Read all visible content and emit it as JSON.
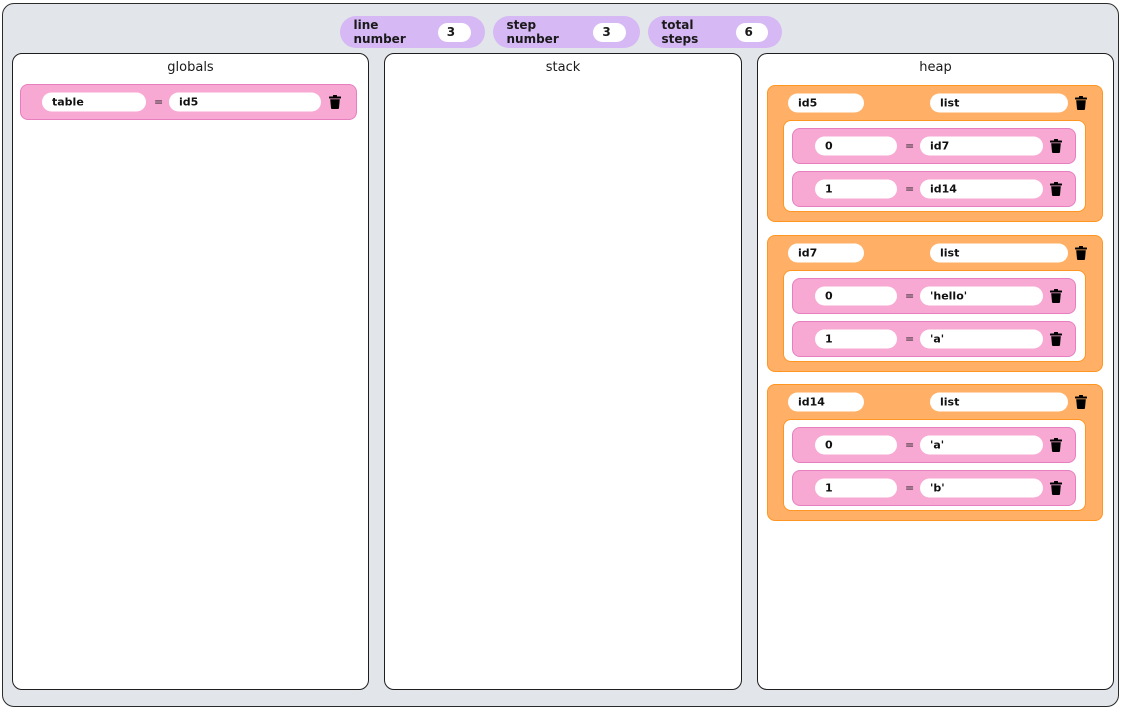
{
  "status": {
    "line_number_label": "line number",
    "line_number_value": "3",
    "step_number_label": "step number",
    "step_number_value": "3",
    "total_steps_label": "total steps",
    "total_steps_value": "6"
  },
  "panels": {
    "globals_title": "globals",
    "stack_title": "stack",
    "heap_title": "heap"
  },
  "globals": [
    {
      "name": "table",
      "value": "id5"
    }
  ],
  "heap": [
    {
      "id": "id5",
      "type": "list",
      "items": [
        {
          "index": "0",
          "value": "id7"
        },
        {
          "index": "1",
          "value": "id14"
        }
      ]
    },
    {
      "id": "id7",
      "type": "list",
      "items": [
        {
          "index": "0",
          "value": "'hello'"
        },
        {
          "index": "1",
          "value": "'a'"
        }
      ]
    },
    {
      "id": "id14",
      "type": "list",
      "items": [
        {
          "index": "0",
          "value": "'a'"
        },
        {
          "index": "1",
          "value": "'b'"
        }
      ]
    }
  ],
  "symbols": {
    "equals": "="
  },
  "colors": {
    "background": "#e2e6ea",
    "status_pill": "#d6b8f5",
    "variable_row": "#f7a8d3",
    "variable_row_border": "#e77fbf",
    "heap_object": "#ffb066",
    "heap_object_border": "#ff9622"
  },
  "icons": {
    "delete": "trash-icon"
  }
}
